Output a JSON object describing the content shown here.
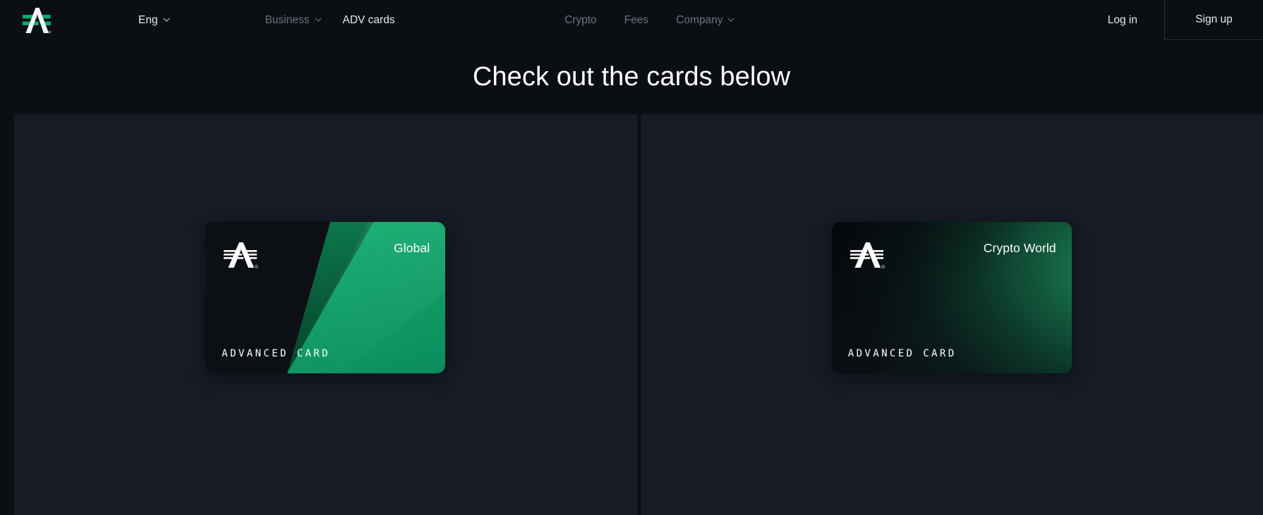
{
  "header": {
    "logo_icon": "advcash-a-logo-icon",
    "language": {
      "label": "Eng",
      "caret_icon": "chevron-down-icon"
    },
    "nav_left": [
      {
        "label": "Business",
        "caret_icon": "chevron-down-icon",
        "muted": true
      },
      {
        "label": "ADV cards",
        "muted": false
      }
    ],
    "nav_center": [
      {
        "label": "Crypto",
        "muted": true
      },
      {
        "label": "Fees",
        "muted": true
      },
      {
        "label": "Company",
        "caret_icon": "chevron-down-icon",
        "muted": true
      }
    ],
    "login_label": "Log in",
    "signup_label": "Sign up"
  },
  "hero": {
    "title": "Check out the cards below"
  },
  "cards": [
    {
      "panel_name": "global-card-panel",
      "title": "Global",
      "brand_text": "ADVANCED CARD",
      "logo_icon": "advcash-a-logo-icon",
      "accent_color": "#10a96d",
      "base_color": "#0c1014"
    },
    {
      "panel_name": "crypto-world-card-panel",
      "title": "Crypto World",
      "brand_text": "ADVANCED CARD",
      "logo_icon": "advcash-a-logo-icon",
      "accent_color": "#1d8a5d",
      "base_color": "#0b0f14"
    }
  ],
  "colors": {
    "page_background": "#0b0e13",
    "panel_background": "#161b25",
    "text_primary": "#e8eaed",
    "text_muted": "#6d737e",
    "brand_green": "#10a96d"
  }
}
